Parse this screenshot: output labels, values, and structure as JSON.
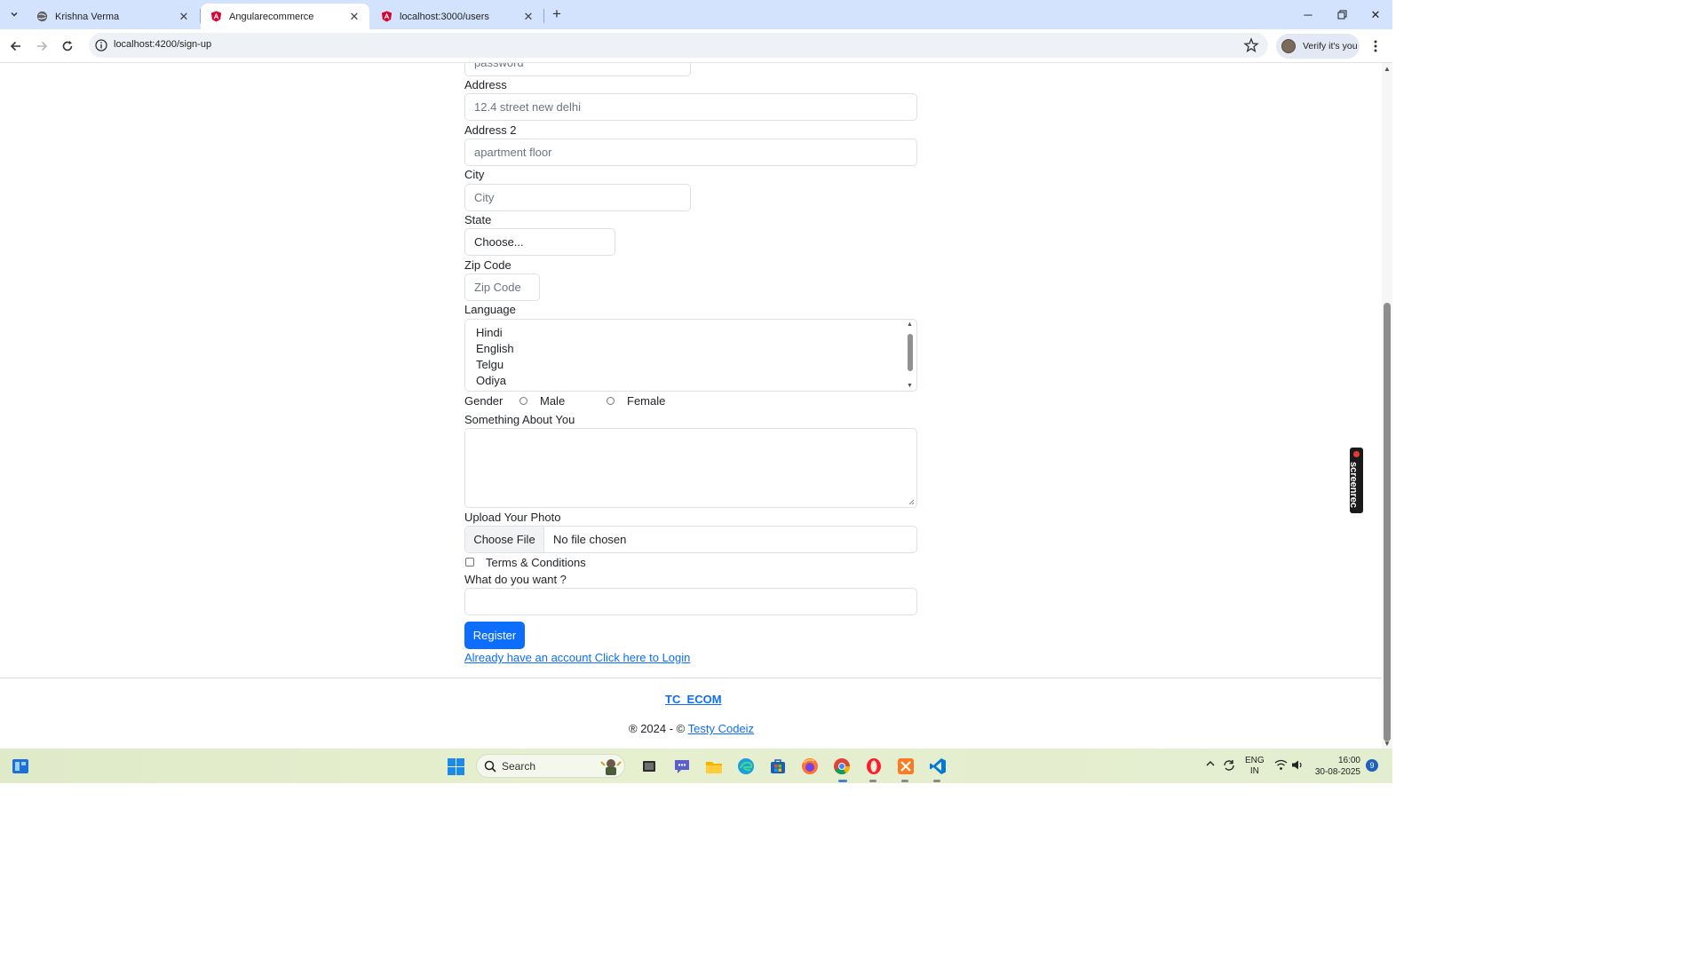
{
  "browser": {
    "tabs": [
      {
        "title": "Krishna Verma",
        "active": false,
        "favicon": "globe-icon"
      },
      {
        "title": "Angularecommerce",
        "active": true,
        "favicon": "angular-icon"
      },
      {
        "title": "localhost:3000/users",
        "active": false,
        "favicon": "angular-icon"
      }
    ],
    "url": "localhost:4200/sign-up",
    "profile_label": "Verify it's you"
  },
  "form": {
    "password_placeholder": "password",
    "address_label": "Address",
    "address_placeholder": "12.4 street new delhi",
    "address2_label": "Address 2",
    "address2_placeholder": "apartment floor",
    "city_label": "City",
    "city_placeholder": "City",
    "state_label": "State",
    "state_selected": "Choose...",
    "zip_label": "Zip Code",
    "zip_placeholder": "Zip Code",
    "language_label": "Language",
    "language_options": [
      "Hindi",
      "English",
      "Telgu",
      "Odiya"
    ],
    "gender_label": "Gender",
    "gender_options": [
      "Male",
      "Female"
    ],
    "about_label": "Something About You",
    "photo_label": "Upload Your Photo",
    "file_button": "Choose File",
    "file_status": "No file chosen",
    "terms_label": "Terms & Conditions",
    "want_label": "What do you want ?",
    "register_button": "Register",
    "login_link": "Already have an account Click here to Login"
  },
  "footer": {
    "brand": "TC_ECOM",
    "copyright_prefix": "® 2024 - ©",
    "company_link": "Testy Codeiz"
  },
  "overlay": {
    "screenrec_label": "screenrec"
  },
  "taskbar": {
    "search_label": "Search",
    "language": "ENG",
    "region": "IN",
    "time": "16:00",
    "date": "30-08-2025",
    "notification_count": "9"
  }
}
